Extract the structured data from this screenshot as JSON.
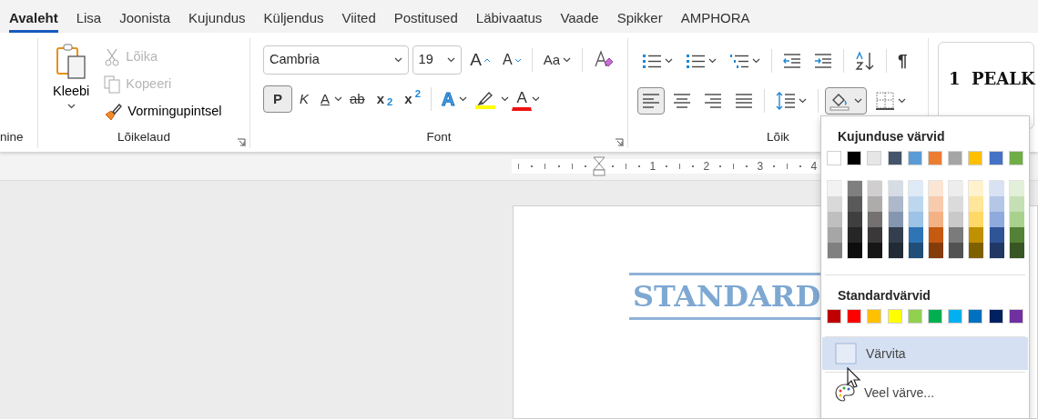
{
  "tabs": [
    {
      "label": "Avaleht",
      "selected": true
    },
    {
      "label": "Lisa",
      "selected": false
    },
    {
      "label": "Joonista",
      "selected": false
    },
    {
      "label": "Kujundus",
      "selected": false
    },
    {
      "label": "Küljendus",
      "selected": false
    },
    {
      "label": "Viited",
      "selected": false
    },
    {
      "label": "Postitused",
      "selected": false
    },
    {
      "label": "Läbivaatus",
      "selected": false
    },
    {
      "label": "Vaade",
      "selected": false
    },
    {
      "label": "Spikker",
      "selected": false
    },
    {
      "label": "AMPHORA",
      "selected": false
    }
  ],
  "partial_group": {
    "label": "nine"
  },
  "clipboard": {
    "label": "Lõikelaud",
    "paste": "Kleebi",
    "cut": {
      "label": "Lõika",
      "disabled": true
    },
    "copy": {
      "label": "Kopeeri",
      "disabled": true
    },
    "painter": {
      "label": "Vormingupintsel",
      "disabled": false
    }
  },
  "font": {
    "label": "Font",
    "name": "Cambria",
    "size": "19",
    "row_1": [
      {
        "kind": "grow",
        "label": "A"
      },
      {
        "kind": "shrink",
        "label": "A"
      },
      {
        "kind": "case",
        "label": "Aa"
      },
      {
        "kind": "clear"
      }
    ],
    "row_2": [
      {
        "kind": "bold",
        "label": "P",
        "selected": true
      },
      {
        "kind": "italic",
        "label": "K",
        "selected": false
      },
      {
        "kind": "underline",
        "label": "A",
        "selected": false
      },
      {
        "kind": "strike",
        "label": "ab",
        "selected": false
      },
      {
        "kind": "subscript",
        "label": "x$_{2}$",
        "selected": false
      },
      {
        "kind": "superscript",
        "label": "x$^{2}$",
        "selected": false
      },
      {
        "kind": "effects",
        "label": "A",
        "selected": false
      },
      {
        "kind": "highlight",
        "selected": false
      },
      {
        "kind": "color",
        "label": "A",
        "selected": false
      }
    ]
  },
  "paragraph": {
    "label": "Lõik",
    "row_1": [
      {
        "kind": "bullets"
      },
      {
        "kind": "numbering"
      },
      {
        "kind": "multilevel"
      },
      {
        "kind": "outdent"
      },
      {
        "kind": "indent"
      },
      {
        "kind": "sort"
      },
      {
        "kind": "pilcrow",
        "label": "¶",
        "selected": false
      }
    ],
    "row_2": [
      {
        "kind": "align-left",
        "selected": true
      },
      {
        "kind": "align-center",
        "selected": false
      },
      {
        "kind": "align-right",
        "selected": false
      },
      {
        "kind": "justify",
        "selected": false
      },
      {
        "kind": "line-spacing",
        "selected": false
      },
      {
        "kind": "shading",
        "selected": true
      },
      {
        "kind": "borders",
        "selected": false
      }
    ]
  },
  "styles": {
    "sample": "1  PEALK"
  },
  "ruler": {
    "numbers": [
      "1",
      "2",
      "3",
      "4"
    ]
  },
  "document": {
    "heading": "STANDARD"
  },
  "shading_menu": {
    "theme_title": "Kujunduse värvid",
    "theme_colors": [
      {
        "color": "#ffffff",
        "shades": [
          {
            "color": "#f2f2f2"
          },
          {
            "color": "#d9d9d9"
          },
          {
            "color": "#bfbfbf"
          },
          {
            "color": "#a6a6a6"
          },
          {
            "color": "#808080"
          }
        ]
      },
      {
        "color": "#000000",
        "shades": [
          {
            "color": "#7f7f7f"
          },
          {
            "color": "#595959"
          },
          {
            "color": "#3f3f3f"
          },
          {
            "color": "#262626"
          },
          {
            "color": "#0d0d0d"
          }
        ]
      },
      {
        "color": "#e7e6e6",
        "shades": [
          {
            "color": "#d0cece"
          },
          {
            "color": "#aeabab"
          },
          {
            "color": "#757171"
          },
          {
            "color": "#3a3838"
          },
          {
            "color": "#171616"
          }
        ]
      },
      {
        "color": "#44546a",
        "shades": [
          {
            "color": "#d6dce4"
          },
          {
            "color": "#adb9ca"
          },
          {
            "color": "#8496b0"
          },
          {
            "color": "#333f4f"
          },
          {
            "color": "#222a35"
          }
        ]
      },
      {
        "color": "#5b9bd5",
        "shades": [
          {
            "color": "#deebf6"
          },
          {
            "color": "#bdd7ee"
          },
          {
            "color": "#9dc3e6"
          },
          {
            "color": "#2e75b5"
          },
          {
            "color": "#1f4e79"
          }
        ]
      },
      {
        "color": "#ed7d31",
        "shades": [
          {
            "color": "#fbe5d5"
          },
          {
            "color": "#f8cbad"
          },
          {
            "color": "#f4b183"
          },
          {
            "color": "#c55a11"
          },
          {
            "color": "#843c0b"
          }
        ]
      },
      {
        "color": "#a5a5a5",
        "shades": [
          {
            "color": "#ededed"
          },
          {
            "color": "#dbdbdb"
          },
          {
            "color": "#c9c9c9"
          },
          {
            "color": "#7b7b7b"
          },
          {
            "color": "#525252"
          }
        ]
      },
      {
        "color": "#ffc000",
        "shades": [
          {
            "color": "#fff2cc"
          },
          {
            "color": "#ffe699"
          },
          {
            "color": "#ffd966"
          },
          {
            "color": "#bf9000"
          },
          {
            "color": "#7f6000"
          }
        ]
      },
      {
        "color": "#4472c4",
        "shades": [
          {
            "color": "#d9e2f3"
          },
          {
            "color": "#b4c7e7"
          },
          {
            "color": "#8faadc"
          },
          {
            "color": "#2f5597"
          },
          {
            "color": "#1f3864"
          }
        ]
      },
      {
        "color": "#70ad47",
        "shades": [
          {
            "color": "#e2f0d9"
          },
          {
            "color": "#c5e0b4"
          },
          {
            "color": "#a9d18e"
          },
          {
            "color": "#538135"
          },
          {
            "color": "#375623"
          }
        ]
      }
    ],
    "standard_title": "Standardvärvid",
    "standard_colors": [
      {
        "color": "#c00000"
      },
      {
        "color": "#ff0000"
      },
      {
        "color": "#ffc000"
      },
      {
        "color": "#ffff00"
      },
      {
        "color": "#92d050"
      },
      {
        "color": "#00b050"
      },
      {
        "color": "#00b0f0"
      },
      {
        "color": "#0070c0"
      },
      {
        "color": "#002060"
      },
      {
        "color": "#7030a0"
      }
    ],
    "items": [
      {
        "kind": "no-color",
        "label": "Värvita",
        "selected": true
      },
      {
        "kind": "more",
        "label": "Veel värve...",
        "selected": false
      }
    ]
  }
}
